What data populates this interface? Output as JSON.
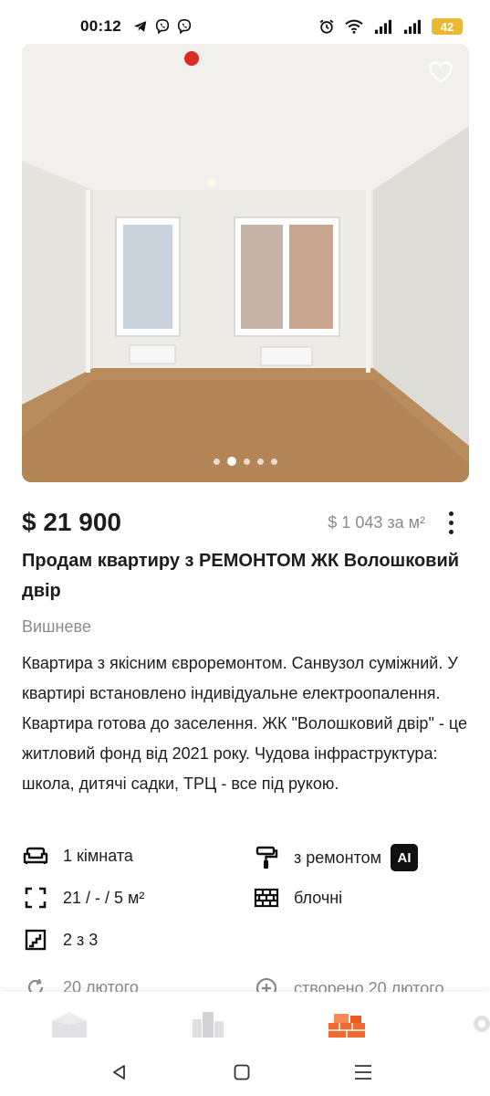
{
  "status_bar": {
    "time": "00:12",
    "battery": "42",
    "icons_left": [
      "telegram-icon",
      "viber-icon",
      "viber-icon"
    ],
    "icons_right": [
      "alarm-icon",
      "wifi-icon",
      "signal-icon",
      "signal-icon",
      "battery-icon"
    ]
  },
  "listing": {
    "photo": {
      "total_images": 5,
      "active_index": 1
    },
    "price": "$ 21 900",
    "price_per_m2": "$ 1 043 за м²",
    "title": "Продам квартиру з РЕМОНТОМ ЖК Волошковий двір",
    "location": "Вишневе",
    "description": "Квартира з якісним євроремонтом. Санвузол суміжний. У квартирі встановлено індивідуальне електроопалення. Квартира готова до заселення. ЖК \"Волошковий двір\" - це житловий фонд від 2021 року. Чудова інфраструктура: школа, дитячі садки, ТРЦ - все під рукою."
  },
  "features": {
    "rooms": "1 кімната",
    "renovation": "з ремонтом",
    "ai_badge": "AI",
    "area": "21 / - / 5 м²",
    "wall_type": "блочні",
    "floor": "2 з 3"
  },
  "meta": {
    "updated": "20 лютого",
    "created": "створено 20 лютого"
  },
  "colors": {
    "accent_orange": "#f26a2e",
    "text_primary": "#1d1d1f",
    "text_secondary": "#8b8b8f",
    "nav_inactive": "#d3d3d6"
  }
}
